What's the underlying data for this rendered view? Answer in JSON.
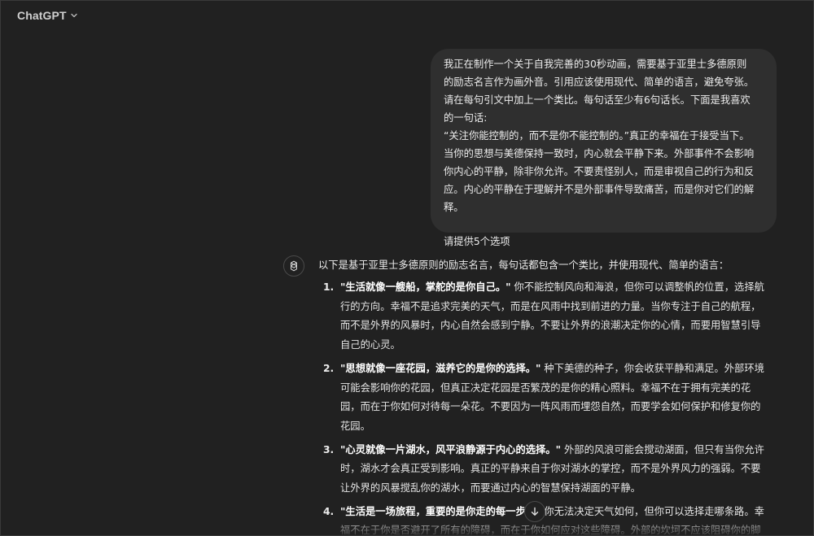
{
  "header": {
    "model_name": "ChatGPT"
  },
  "user_message": {
    "lines": [
      "我正在制作一个关于自我完善的30秒动画，需要基于亚里士多德原则",
      "的励志名言作为画外音。引用应该使用现代、简单的语言，避免夸张。",
      "请在每句引文中加上一个类比。每句话至少有6句话长。下面是我喜欢",
      "的一句话:",
      "“关注你能控制的，而不是你不能控制的。”真正的幸福在于接受当下。",
      "当你的思想与美德保持一致时，内心就会平静下来。外部事件不会影响",
      "你内心的平静，除非你允许。不要责怪别人，而是审视自己的行为和反",
      "应。内心的平静在于理解并不是外部事件导致痛苦，而是你对它们的解",
      "释。"
    ],
    "request": "请提供5个选项"
  },
  "assistant": {
    "intro": "以下是基于亚里士多德原则的励志名言，每句话都包含一个类比，并使用现代、简单的语言：",
    "items": [
      {
        "num": "1.",
        "bold": "\"生活就像一艘船，掌舵的是你自己。\"",
        "first_rest": " 你不能控制风向和海浪，但你可以调整帆的位置，选择航",
        "lines": [
          "行的方向。幸福不是追求完美的天气，而是在风雨中找到前进的力量。当你专注于自己的航程，",
          "而不是外界的风暴时，内心自然会感到宁静。不要让外界的浪潮决定你的心情，而要用智慧引导",
          "自己的心灵。"
        ]
      },
      {
        "num": "2.",
        "bold": "\"思想就像一座花园，滋养它的是你的选择。\"",
        "first_rest": " 种下美德的种子，你会收获平静和满足。外部环境",
        "lines": [
          "可能会影响你的花园，但真正决定花园是否繁茂的是你的精心照料。幸福不在于拥有完美的花",
          "园，而在于你如何对待每一朵花。不要因为一阵风雨而埋怨自然，而要学会如何保护和修复你的",
          "花园。"
        ]
      },
      {
        "num": "3.",
        "bold": "\"心灵就像一片湖水，风平浪静源于内心的选择。\"",
        "first_rest": " 外部的风浪可能会搅动湖面，但只有当你允许",
        "lines": [
          "时，湖水才会真正受到影响。真正的平静来自于你对湖水的掌控，而不是外界风力的强弱。不要",
          "让外界的风暴搅乱你的湖水，而要通过内心的智慧保持湖面的平静。"
        ]
      },
      {
        "num": "4.",
        "bold": "\"生活是一场旅程，重要的是你走的每一步。\"",
        "first_rest": " 你无法决定天气如何，但你可以选择走哪条路。幸",
        "lines": [
          "福不在于你是否避开了所有的障碍，而在于你如何应对这些障碍。外部的坎坷不应该阻碍你的脚"
        ]
      }
    ]
  },
  "icons": {
    "chevron": "chevron-down-icon",
    "avatar": "openai-logo-icon",
    "scroll": "arrow-down-icon"
  }
}
